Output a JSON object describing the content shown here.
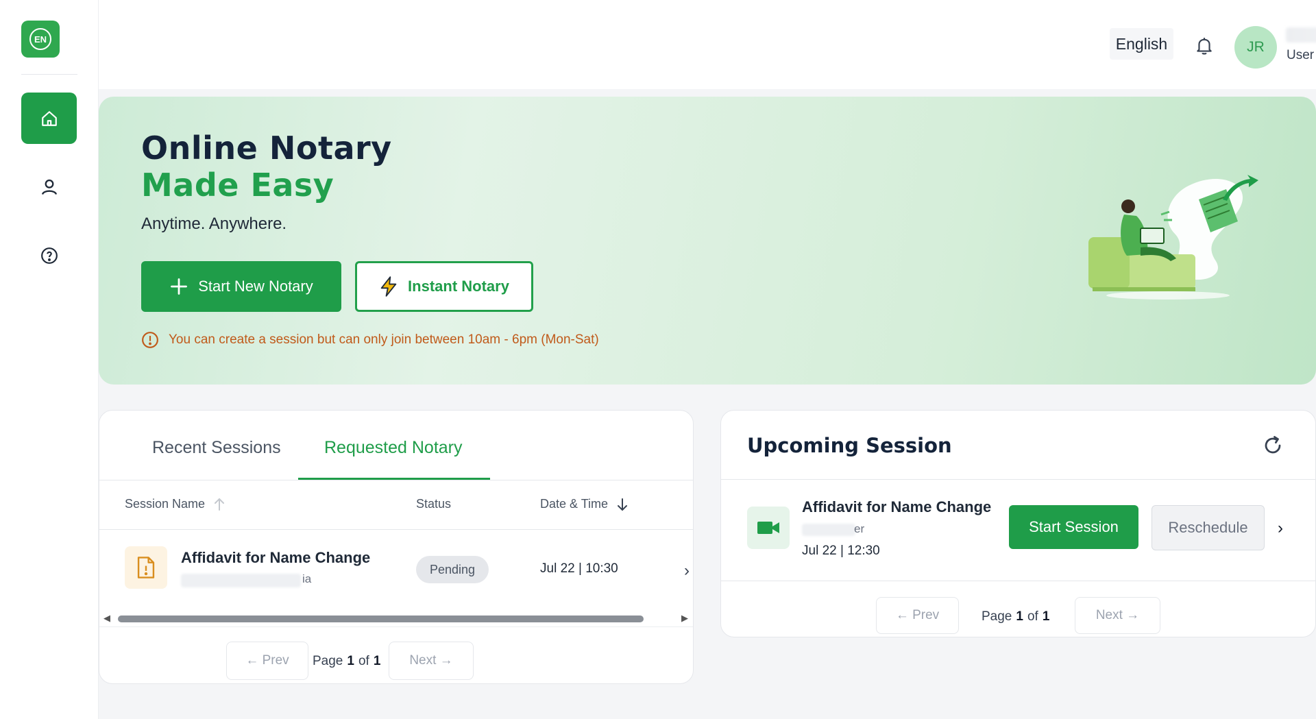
{
  "logo": {
    "text": "EN"
  },
  "header": {
    "language": "English",
    "avatar_initials": "JR",
    "user_role": "User"
  },
  "hero": {
    "title_line1": "Online Notary",
    "title_line2": "Made Easy",
    "subtitle": "Anytime. Anywhere.",
    "start_button": "Start New Notary",
    "instant_button": "Instant Notary",
    "notice": "You can create a session but can only join between 10am - 6pm (Mon-Sat)"
  },
  "sessions": {
    "tabs": [
      {
        "label": "Recent Sessions",
        "active": false
      },
      {
        "label": "Requested Notary",
        "active": true
      }
    ],
    "columns": {
      "name": "Session Name",
      "status": "Status",
      "date": "Date & Time"
    },
    "rows": [
      {
        "title": "Affidavit for Name Change",
        "sub_tail": "ia",
        "status": "Pending",
        "datetime": "Jul 22 | 10:30"
      }
    ],
    "pager": {
      "prev": "← Prev",
      "next": "Next →",
      "page_label": "Page",
      "current": "1",
      "of_label": "of",
      "total": "1"
    }
  },
  "upcoming": {
    "title": "Upcoming Session",
    "item": {
      "title": "Affidavit for Name Change",
      "sub_tail": "er",
      "datetime": "Jul 22 | 12:30"
    },
    "start_button": "Start Session",
    "reschedule_button": "Reschedule",
    "pager": {
      "prev": "← Prev",
      "next": "Next →",
      "page_label": "Page",
      "current": "1",
      "of_label": "of",
      "total": "1"
    }
  },
  "colors": {
    "brand": "#1f9d49",
    "notice": "#c05a1a",
    "pending_bg": "#e5e7eb"
  }
}
